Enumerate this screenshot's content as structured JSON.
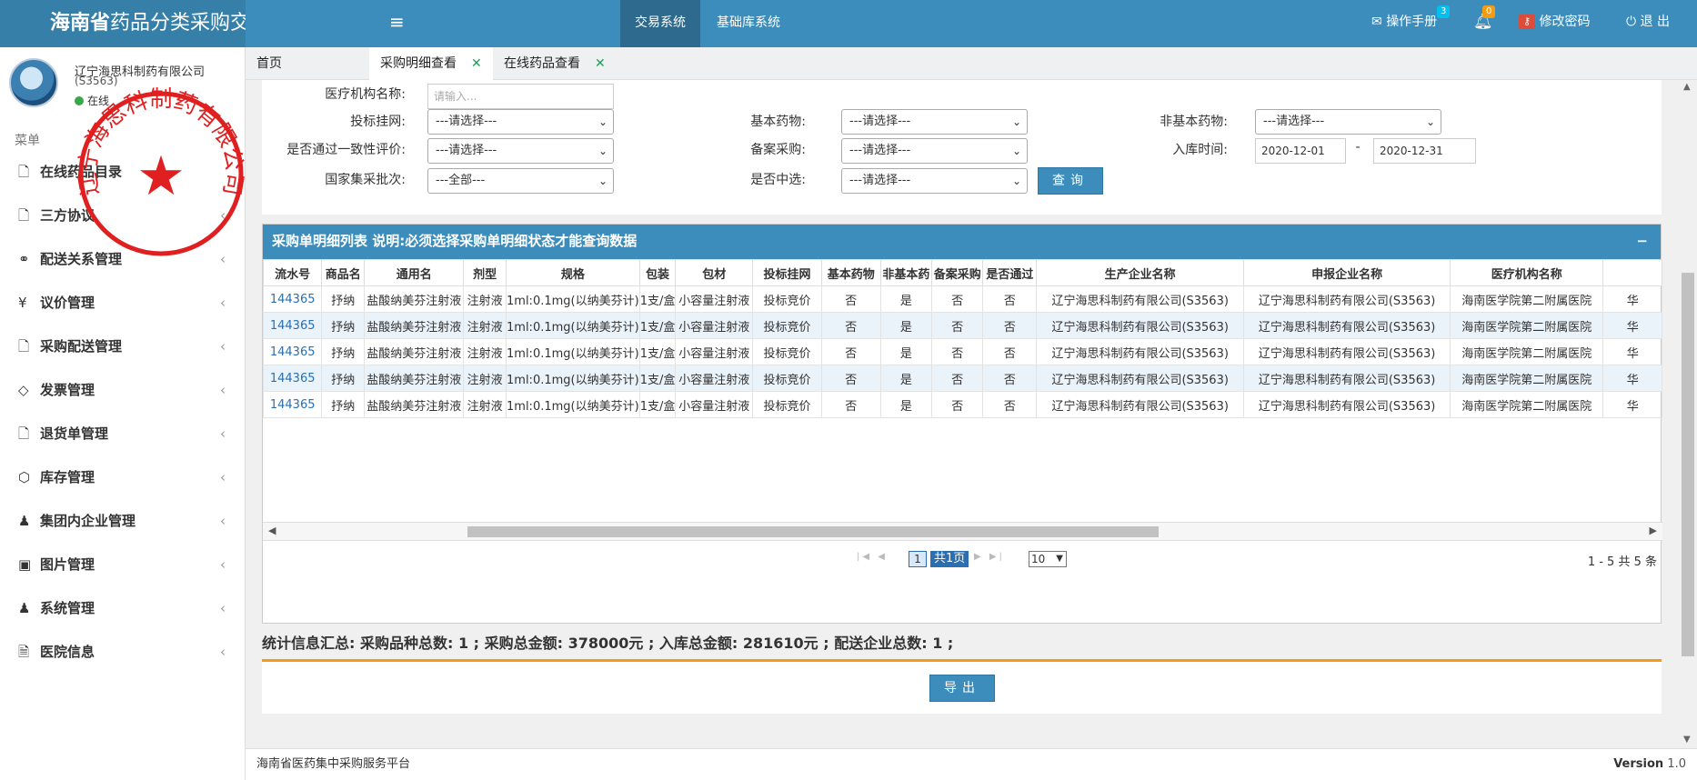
{
  "app": {
    "title_bold": "海南省",
    "title_rest": "药品分类采购交易系统",
    "menu_toggle": "≡",
    "nav": [
      "交易系统",
      "基础库系统"
    ]
  },
  "topright": {
    "manual": "操作手册",
    "manual_badge": "3",
    "bell_badge": "0",
    "change_password": "修改密码",
    "logout": "退 出",
    "manual_badge_color": "#00c0ef",
    "bell_badge_color": "#f39c12"
  },
  "user": {
    "name": "辽宁海思科制药有限公司",
    "code": "(S3563)",
    "status": "在线"
  },
  "seal": {
    "text": "辽宁海思科制药有限公司",
    "star": "★",
    "color": "#e02020"
  },
  "sidebar": {
    "header": "菜单",
    "items": [
      {
        "icon": "file-icon",
        "glyph": "🗋",
        "label": "在线药品目录",
        "has_children": false
      },
      {
        "icon": "file-icon",
        "glyph": "🗋",
        "label": "三方协议",
        "has_children": true
      },
      {
        "icon": "link-icon",
        "glyph": "⚭",
        "label": "配送关系管理",
        "has_children": true
      },
      {
        "icon": "yen-icon",
        "glyph": "¥",
        "label": "议价管理",
        "has_children": true
      },
      {
        "icon": "file-icon",
        "glyph": "🗋",
        "label": "采购配送管理",
        "has_children": true
      },
      {
        "icon": "tag-icon",
        "glyph": "◇",
        "label": "发票管理",
        "has_children": true
      },
      {
        "icon": "file-icon",
        "glyph": "🗋",
        "label": "退货单管理",
        "has_children": true
      },
      {
        "icon": "cubes-icon",
        "glyph": "⬡",
        "label": "库存管理",
        "has_children": true
      },
      {
        "icon": "user-icon",
        "glyph": "♟",
        "label": "集团内企业管理",
        "has_children": true
      },
      {
        "icon": "image-icon",
        "glyph": "▣",
        "label": "图片管理",
        "has_children": true
      },
      {
        "icon": "user-icon",
        "glyph": "♟",
        "label": "系统管理",
        "has_children": true
      },
      {
        "icon": "doc-icon",
        "glyph": "🗎",
        "label": "医院信息",
        "has_children": true
      }
    ]
  },
  "page_tabs": [
    {
      "label": "首页",
      "closable": false
    },
    {
      "label": "采购明细查看",
      "closable": true
    },
    {
      "label": "在线药品查看",
      "closable": true
    }
  ],
  "filters": {
    "institution_label": "医疗机构名称:",
    "institution_placeholder": "请输入...",
    "bid_label": "投标挂网:",
    "bid_value": "---请选择---",
    "basic_label": "基本药物:",
    "basic_value": "---请选择---",
    "nonbasic_label": "非基本药物:",
    "nonbasic_value": "---请选择---",
    "consistency_label": "是否通过一致性评价:",
    "consistency_value": "---请选择---",
    "filing_label": "备案采购:",
    "filing_value": "---请选择---",
    "date_label": "入库时间:",
    "date_from": "2020-12-01",
    "date_sep": "-",
    "date_to": "2020-12-31",
    "batch_label": "国家集采批次:",
    "batch_value": "---全部---",
    "selected_label": "是否中选:",
    "selected_value": "---请选择---",
    "query_button": "查询"
  },
  "table": {
    "title": "采购单明细列表 说明:必须选择采购单明细状态才能查询数据",
    "collapse": "−",
    "columns": [
      "流水号",
      "商品名",
      "通用名",
      "剂型",
      "规格",
      "包装",
      "包材",
      "投标挂网",
      "基本药物",
      "非基本药",
      "备案采购",
      "是否通过",
      "生产企业名称",
      "申报企业名称",
      "医疗机构名称",
      ""
    ],
    "rows": [
      [
        "144365",
        "抒纳",
        "盐酸纳美芬注射液",
        "注射液",
        "1ml:0.1mg(以纳美芬计)",
        "1支/盒",
        "小容量注射液",
        "投标竞价",
        "否",
        "是",
        "否",
        "否",
        "辽宁海思科制药有限公司(S3563)",
        "辽宁海思科制药有限公司(S3563)",
        "海南医学院第二附属医院",
        "华"
      ],
      [
        "144365",
        "抒纳",
        "盐酸纳美芬注射液",
        "注射液",
        "1ml:0.1mg(以纳美芬计)",
        "1支/盒",
        "小容量注射液",
        "投标竞价",
        "否",
        "是",
        "否",
        "否",
        "辽宁海思科制药有限公司(S3563)",
        "辽宁海思科制药有限公司(S3563)",
        "海南医学院第二附属医院",
        "华"
      ],
      [
        "144365",
        "抒纳",
        "盐酸纳美芬注射液",
        "注射液",
        "1ml:0.1mg(以纳美芬计)",
        "1支/盒",
        "小容量注射液",
        "投标竞价",
        "否",
        "是",
        "否",
        "否",
        "辽宁海思科制药有限公司(S3563)",
        "辽宁海思科制药有限公司(S3563)",
        "海南医学院第二附属医院",
        "华"
      ],
      [
        "144365",
        "抒纳",
        "盐酸纳美芬注射液",
        "注射液",
        "1ml:0.1mg(以纳美芬计)",
        "1支/盒",
        "小容量注射液",
        "投标竞价",
        "否",
        "是",
        "否",
        "否",
        "辽宁海思科制药有限公司(S3563)",
        "辽宁海思科制药有限公司(S3563)",
        "海南医学院第二附属医院",
        "华"
      ],
      [
        "144365",
        "抒纳",
        "盐酸纳美芬注射液",
        "注射液",
        "1ml:0.1mg(以纳美芬计)",
        "1支/盒",
        "小容量注射液",
        "投标竞价",
        "否",
        "是",
        "否",
        "否",
        "辽宁海思科制药有限公司(S3563)",
        "辽宁海思科制药有限公司(S3563)",
        "海南医学院第二附属医院",
        "华"
      ]
    ]
  },
  "pager": {
    "current": "1",
    "total": "共1页",
    "page_size": "10",
    "info": "1 - 5 共 5 条"
  },
  "stats": {
    "text": "统计信息汇总: 采购品种总数: 1 ; 采购总金额: 378000元 ; 入库总金额: 281610元 ; 配送企业总数: 1 ;"
  },
  "export_button": "导出",
  "footer": {
    "left": "海南省医药集中采购服务平台",
    "version_label": "Version",
    "version": "1.0"
  }
}
